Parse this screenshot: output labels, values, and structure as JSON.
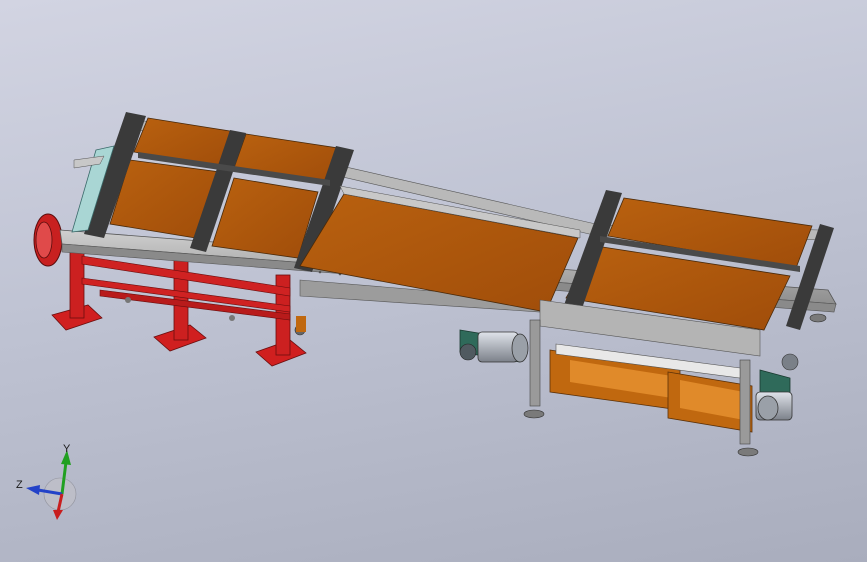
{
  "viewport": {
    "background_top": "#d2d4e2",
    "background_bottom": "#a9adbd"
  },
  "model": {
    "plate_color": "#b0560f",
    "frame_color": "#a8a8a8",
    "leg_color": "#d01f1f",
    "support_color": "#c0680f",
    "motor_color": "#b8bcc4"
  },
  "triad": {
    "x_label": "",
    "y_label": "Y",
    "z_label": "Z",
    "x_color": "#c81e1e",
    "y_color": "#21a021",
    "z_color": "#2342c8"
  }
}
